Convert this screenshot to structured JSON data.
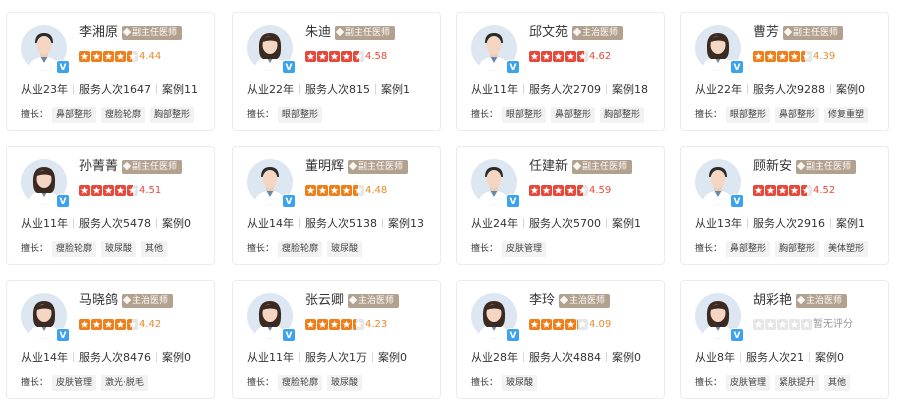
{
  "colors": {
    "star_full": "#ef7f1a",
    "star_full_red": "#e8483a",
    "star_empty": "#e6e6e6",
    "rating_orange": "#e88a2b",
    "rating_red": "#e8483a",
    "rating_gray": "#999999",
    "badge": "#b3a18f",
    "verify": "#3aa2ee"
  },
  "labels": {
    "specialty_prefix": "擅长："
  },
  "doctors": [
    {
      "name": "李湘原",
      "title": "副主任医师",
      "rating": 4.44,
      "rating_text": "4.44",
      "star_color": "orange",
      "years": "从业23年",
      "services": "服务人次1647",
      "cases": "案例11",
      "tags": [
        "鼻部整形",
        "瘦脸轮廓",
        "胸部整形"
      ],
      "avatar_icon": "doctor-male-avatar-icon"
    },
    {
      "name": "朱迪",
      "title": "副主任医师",
      "rating": 4.58,
      "rating_text": "4.58",
      "star_color": "red",
      "years": "从业22年",
      "services": "服务人次815",
      "cases": "案例1",
      "tags": [
        "眼部整形"
      ],
      "avatar_icon": "doctor-female-avatar-icon"
    },
    {
      "name": "邱文苑",
      "title": "主治医师",
      "rating": 4.62,
      "rating_text": "4.62",
      "star_color": "red",
      "years": "从业11年",
      "services": "服务人次2709",
      "cases": "案例18",
      "tags": [
        "眼部整形",
        "鼻部整形",
        "胸部整形"
      ],
      "avatar_icon": "doctor-male-avatar-icon"
    },
    {
      "name": "曹芳",
      "title": "副主任医师",
      "rating": 4.39,
      "rating_text": "4.39",
      "star_color": "orange",
      "years": "从业22年",
      "services": "服务人次9288",
      "cases": "案例0",
      "tags": [
        "眼部整形",
        "鼻部整形",
        "修复重塑"
      ],
      "avatar_icon": "doctor-female-avatar-icon"
    },
    {
      "name": "孙菁菁",
      "title": "副主任医师",
      "rating": 4.51,
      "rating_text": "4.51",
      "star_color": "red",
      "years": "从业11年",
      "services": "服务人次5478",
      "cases": "案例0",
      "tags": [
        "瘦脸轮廓",
        "玻尿酸",
        "其他"
      ],
      "avatar_icon": "doctor-female-avatar-icon"
    },
    {
      "name": "董明辉",
      "title": "副主任医师",
      "rating": 4.48,
      "rating_text": "4.48",
      "star_color": "orange",
      "years": "从业14年",
      "services": "服务人次5138",
      "cases": "案例13",
      "tags": [
        "瘦脸轮廓",
        "玻尿酸"
      ],
      "avatar_icon": "doctor-male-avatar-icon"
    },
    {
      "name": "任建新",
      "title": "副主任医师",
      "rating": 4.59,
      "rating_text": "4.59",
      "star_color": "red",
      "years": "从业24年",
      "services": "服务人次5700",
      "cases": "案例1",
      "tags": [
        "皮肤管理"
      ],
      "avatar_icon": "doctor-male-avatar-icon"
    },
    {
      "name": "顾新安",
      "title": "副主任医师",
      "rating": 4.52,
      "rating_text": "4.52",
      "star_color": "red",
      "years": "从业13年",
      "services": "服务人次2916",
      "cases": "案例1",
      "tags": [
        "鼻部整形",
        "胸部整形",
        "美体塑形"
      ],
      "avatar_icon": "doctor-male-avatar-icon"
    },
    {
      "name": "马晓鸽",
      "title": "主治医师",
      "rating": 4.42,
      "rating_text": "4.42",
      "star_color": "orange",
      "years": "从业14年",
      "services": "服务人次8476",
      "cases": "案例0",
      "tags": [
        "皮肤管理",
        "激光·脱毛"
      ],
      "avatar_icon": "doctor-female-avatar-icon"
    },
    {
      "name": "张云卿",
      "title": "主治医师",
      "rating": 4.23,
      "rating_text": "4.23",
      "star_color": "orange",
      "years": "从业11年",
      "services": "服务人次1万",
      "cases": "案例0",
      "tags": [
        "瘦脸轮廓",
        "玻尿酸"
      ],
      "avatar_icon": "doctor-female-avatar-icon"
    },
    {
      "name": "李玲",
      "title": "主治医师",
      "rating": 4.09,
      "rating_text": "4.09",
      "star_color": "orange",
      "years": "从业28年",
      "services": "服务人次4884",
      "cases": "案例0",
      "tags": [
        "玻尿酸"
      ],
      "avatar_icon": "doctor-female-avatar-icon"
    },
    {
      "name": "胡彩艳",
      "title": "主治医师",
      "rating": 0,
      "rating_text": "暂无评分",
      "star_color": "gray",
      "years": "从业8年",
      "services": "服务人次21",
      "cases": "案例0",
      "tags": [
        "皮肤管理",
        "紧肤提升",
        "其他"
      ],
      "avatar_icon": "doctor-female-avatar-icon"
    }
  ]
}
